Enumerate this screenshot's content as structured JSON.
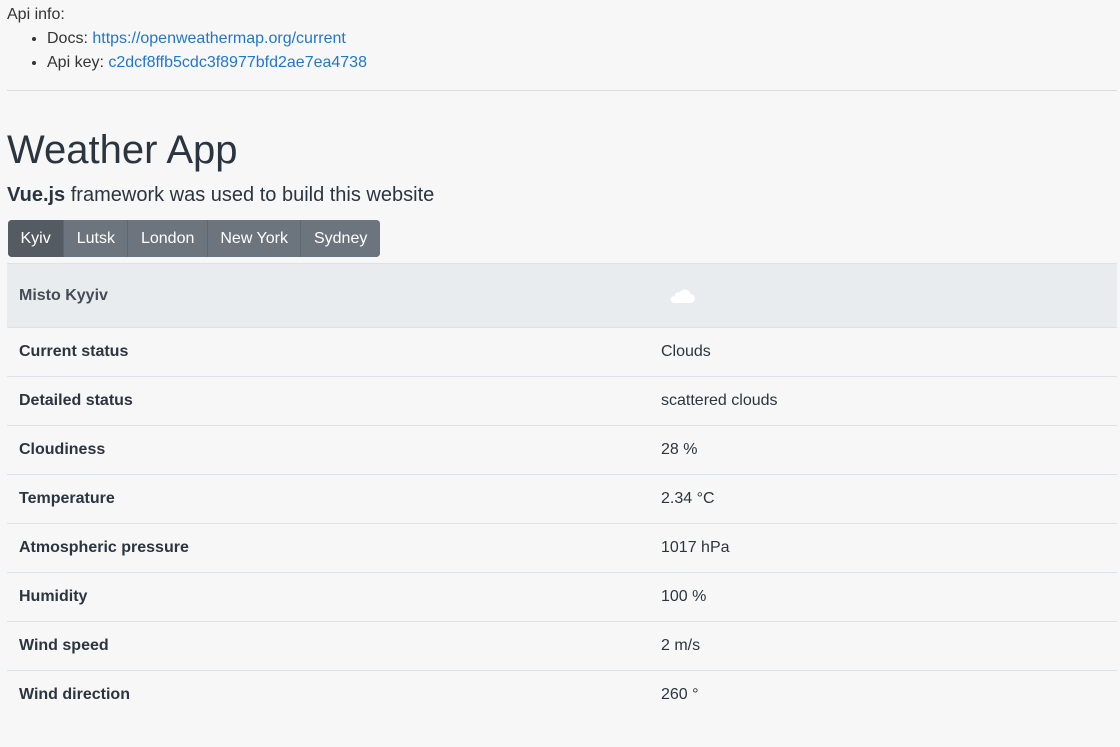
{
  "api_info": {
    "heading": "Api info:",
    "docs_label": "Docs:",
    "docs_link": "https://openweathermap.org/current",
    "key_label": "Api key:",
    "key_value": "c2dcf8ffb5cdc3f8977bfd2ae7ea4738"
  },
  "title": "Weather App",
  "subtitle": {
    "bold": "Vue.js",
    "rest": "framework was used to build this website"
  },
  "cities": [
    {
      "label": "Kyiv",
      "active": true
    },
    {
      "label": "Lutsk",
      "active": false
    },
    {
      "label": "London",
      "active": false
    },
    {
      "label": "New York",
      "active": false
    },
    {
      "label": "Sydney",
      "active": false
    }
  ],
  "table": {
    "city_name": "Misto Kyyiv",
    "icon": "cloud-icon",
    "rows": [
      {
        "label": "Current status",
        "value": "Clouds"
      },
      {
        "label": "Detailed status",
        "value": "scattered clouds"
      },
      {
        "label": "Cloudiness",
        "value": "28 %"
      },
      {
        "label": "Temperature",
        "value": "2.34 °C"
      },
      {
        "label": "Atmospheric pressure",
        "value": "1017 hPa"
      },
      {
        "label": "Humidity",
        "value": "100 %"
      },
      {
        "label": "Wind speed",
        "value": "2 m/s"
      },
      {
        "label": "Wind direction",
        "value": "260 °"
      }
    ]
  },
  "colors": {
    "link": "#2277cc",
    "button": "#6c757d",
    "button_active": "#545b62",
    "table_head": "#e9ecef"
  }
}
